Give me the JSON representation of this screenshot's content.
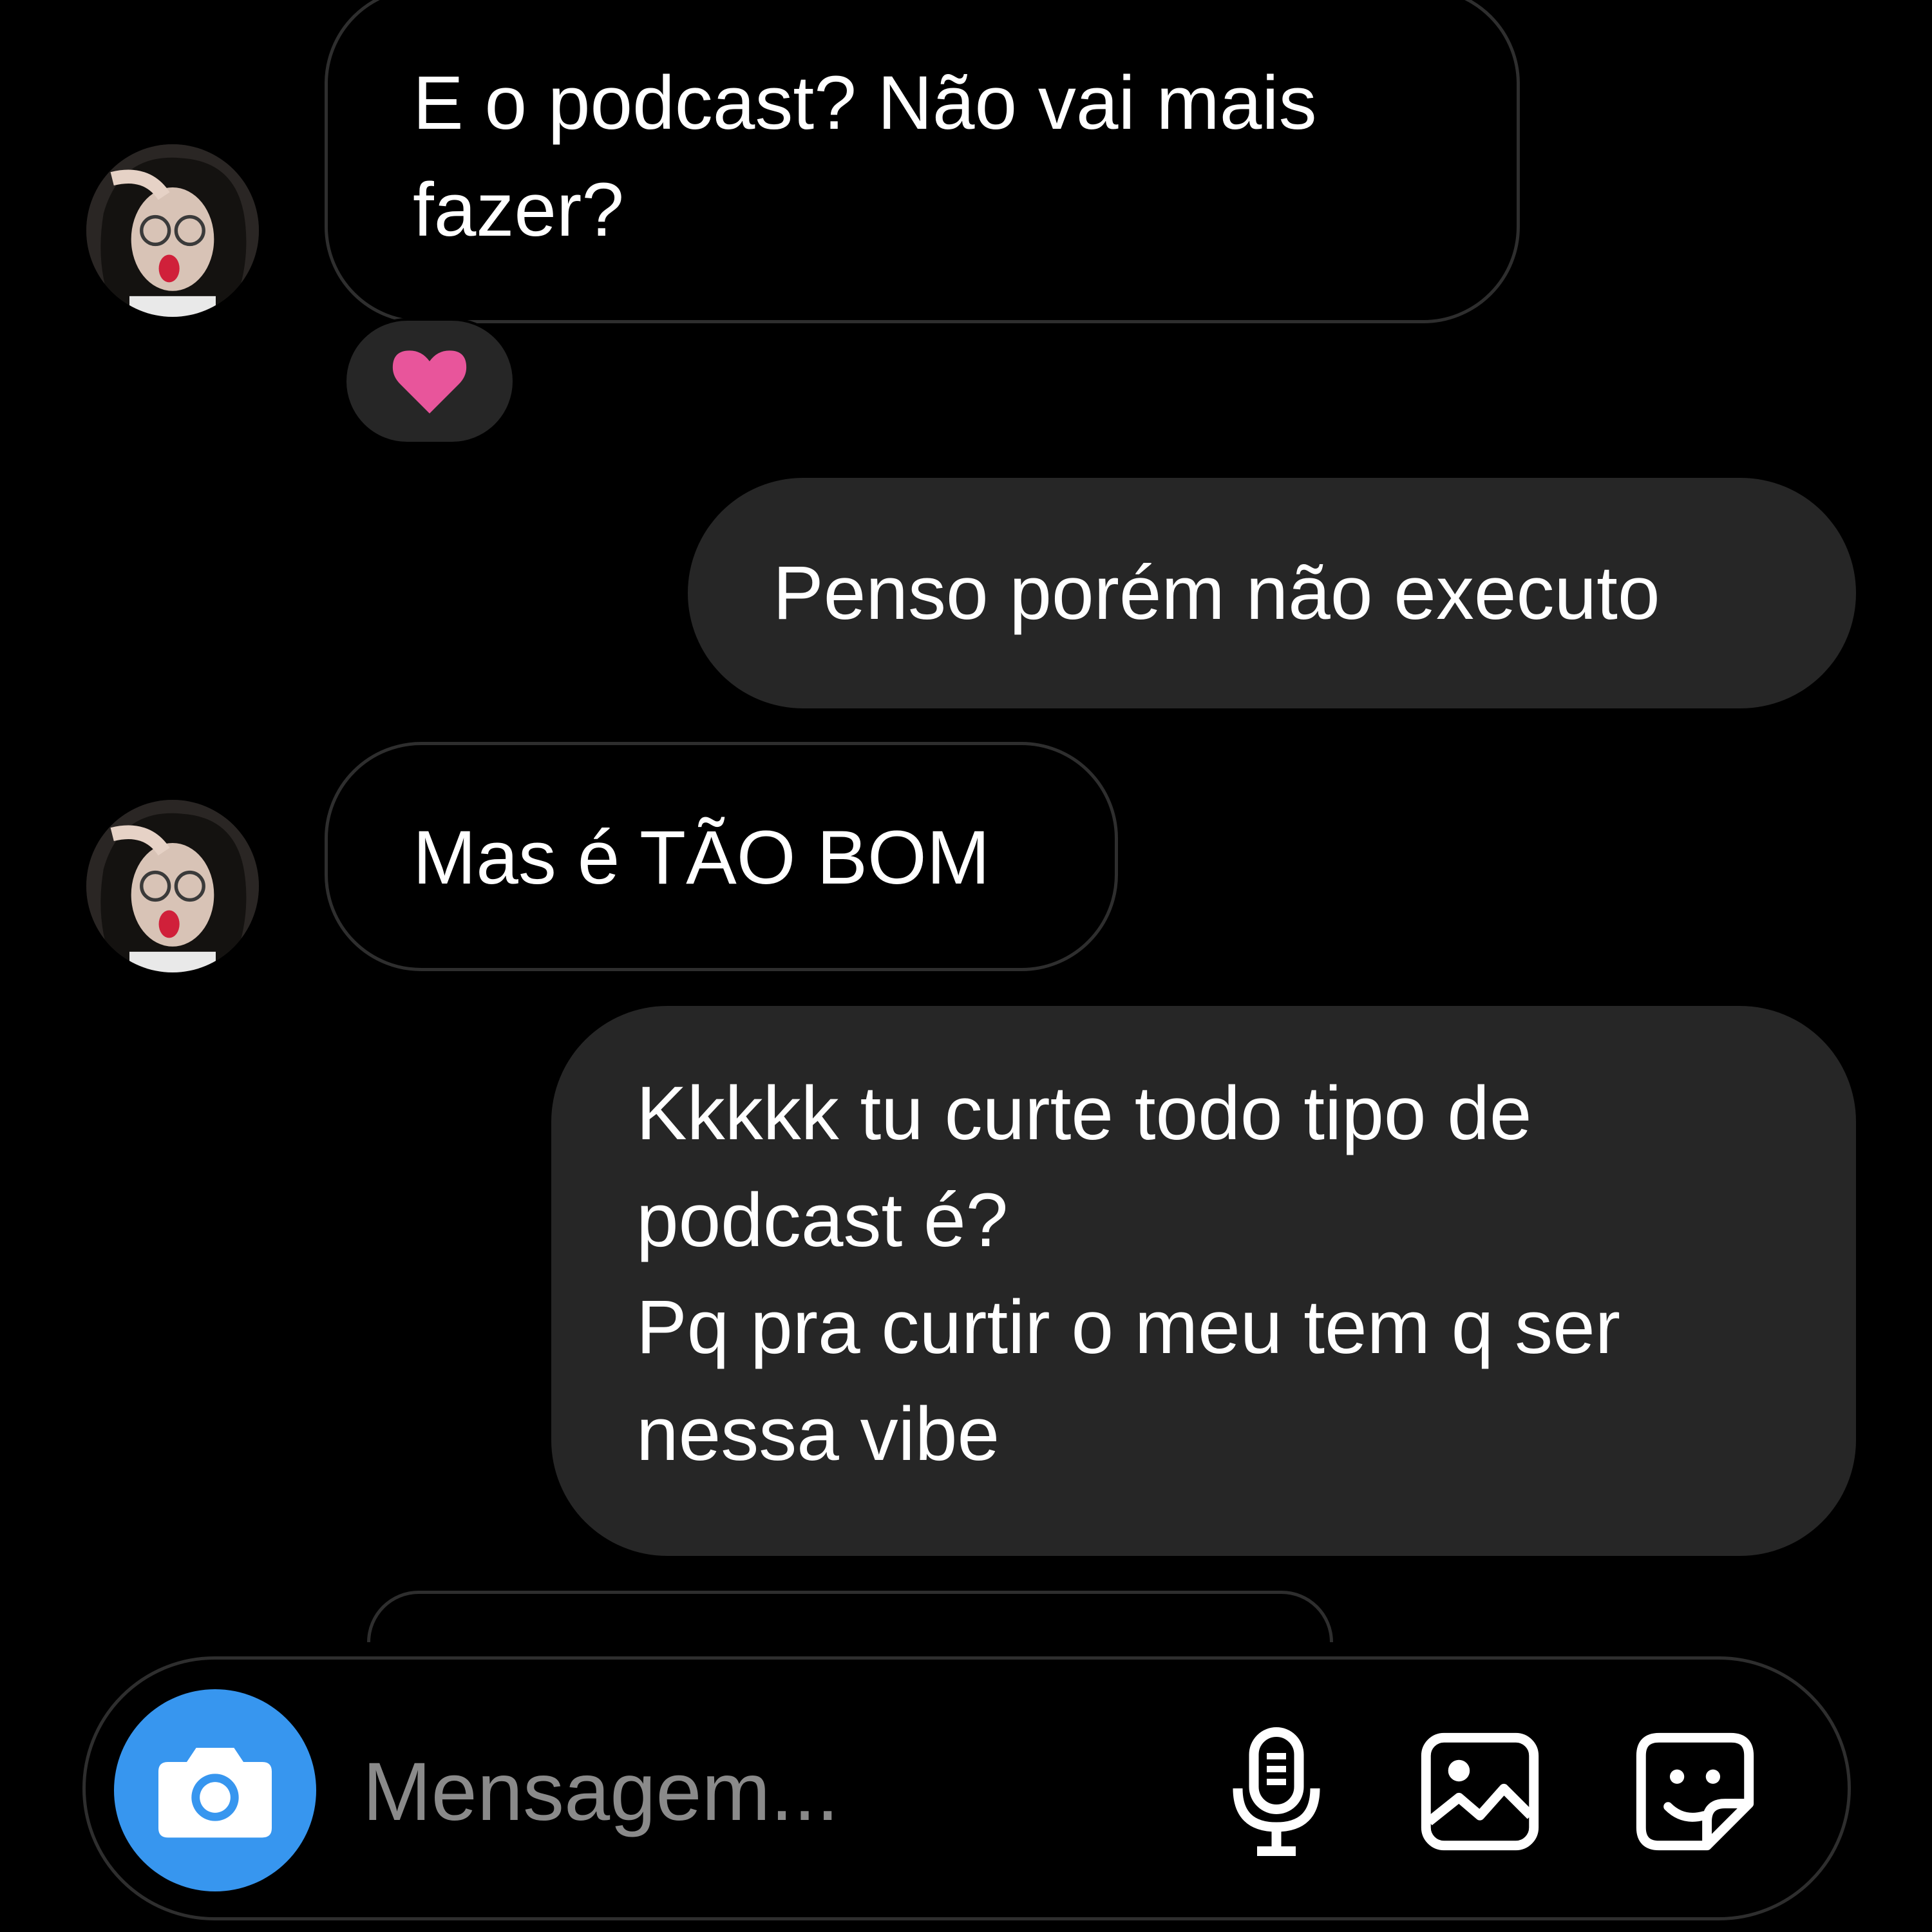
{
  "messages": [
    {
      "direction": "received",
      "lines": [
        "E o podcast? Não vai mais",
        "fazer?"
      ],
      "reaction": "heart"
    },
    {
      "direction": "sent",
      "lines": [
        "Penso porém não executo"
      ]
    },
    {
      "direction": "received",
      "lines": [
        "Mas é TÃO BOM"
      ]
    },
    {
      "direction": "sent",
      "lines": [
        "Kkkkk tu curte todo tipo de",
        "podcast é?",
        "Pq pra curtir o meu tem q ser",
        "nessa vibe"
      ]
    }
  ],
  "composer": {
    "placeholder": "Mensagem...",
    "icons": [
      "camera-icon",
      "microphone-icon",
      "gallery-icon",
      "sticker-icon"
    ]
  },
  "colors": {
    "background": "#000000",
    "sent_bubble": "#262626",
    "received_border": "#2e2e2e",
    "camera_button": "#3796ef",
    "heart": "#e8559b",
    "placeholder": "#8a8a8a"
  }
}
